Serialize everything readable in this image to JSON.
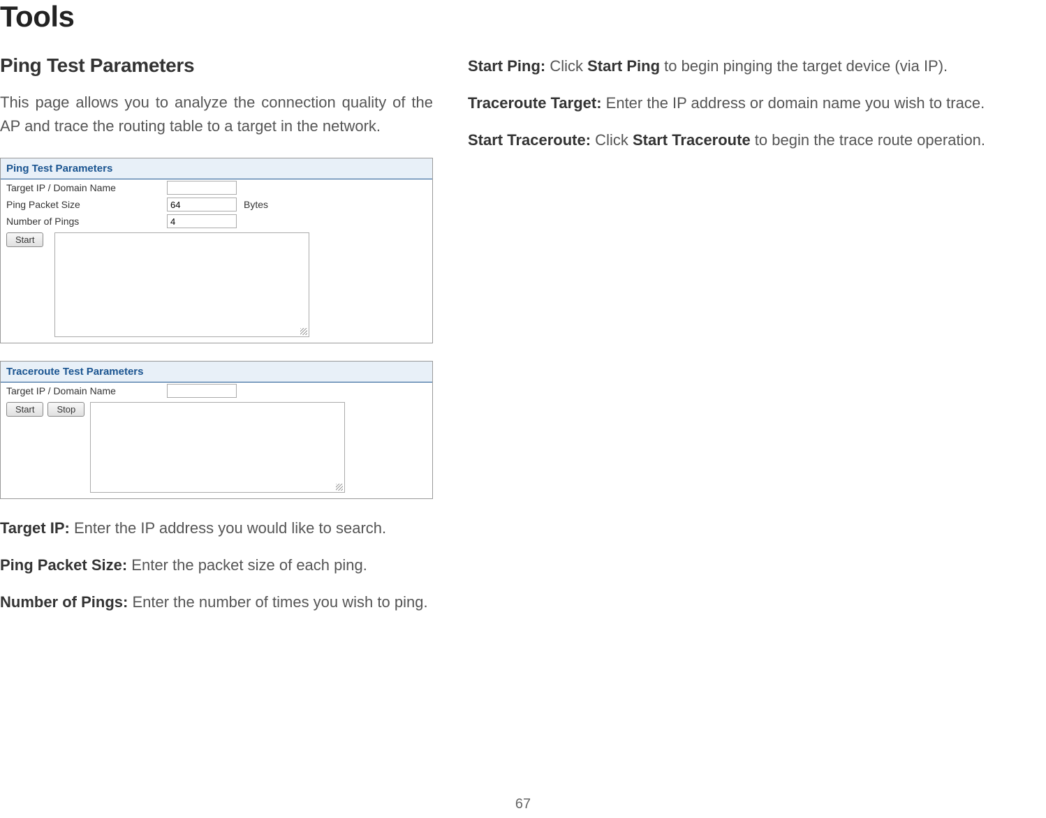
{
  "page": {
    "number": "67",
    "main_title": "Tools"
  },
  "left": {
    "section_title": "Ping Test Parameters",
    "intro": "This page allows you to analyze the connection quality of the AP and trace the routing table to a target in the network.",
    "ping_panel": {
      "title": "Ping Test Parameters",
      "target_label": "Target IP / Domain Name",
      "target_value": "",
      "packet_size_label": "Ping Packet Size",
      "packet_size_value": "64",
      "packet_size_unit": "Bytes",
      "num_pings_label": "Number of Pings",
      "num_pings_value": "4",
      "start_button": "Start"
    },
    "trace_panel": {
      "title": "Traceroute Test Parameters",
      "target_label": "Target IP / Domain Name",
      "target_value": "",
      "start_button": "Start",
      "stop_button": "Stop"
    },
    "defs": {
      "target_ip_label": "Target IP:",
      "target_ip_text": " Enter the IP address you would like to search.",
      "packet_size_label": "Ping Packet Size:",
      "packet_size_text": " Enter the packet size of each ping.",
      "num_pings_label": "Number of Pings:",
      "num_pings_text": " Enter the number of times you wish to ping."
    }
  },
  "right": {
    "start_ping_label": "Start Ping:",
    "start_ping_pre": " Click ",
    "start_ping_bold": "Start Ping",
    "start_ping_post": " to begin pinging the target device (via IP).",
    "trace_target_label": "Traceroute Target:",
    "trace_target_text": " Enter the IP address or domain name you wish to trace.",
    "start_trace_label": "Start Traceroute:",
    "start_trace_pre": " Click ",
    "start_trace_bold": "Start Traceroute",
    "start_trace_post": " to begin the trace route operation."
  }
}
